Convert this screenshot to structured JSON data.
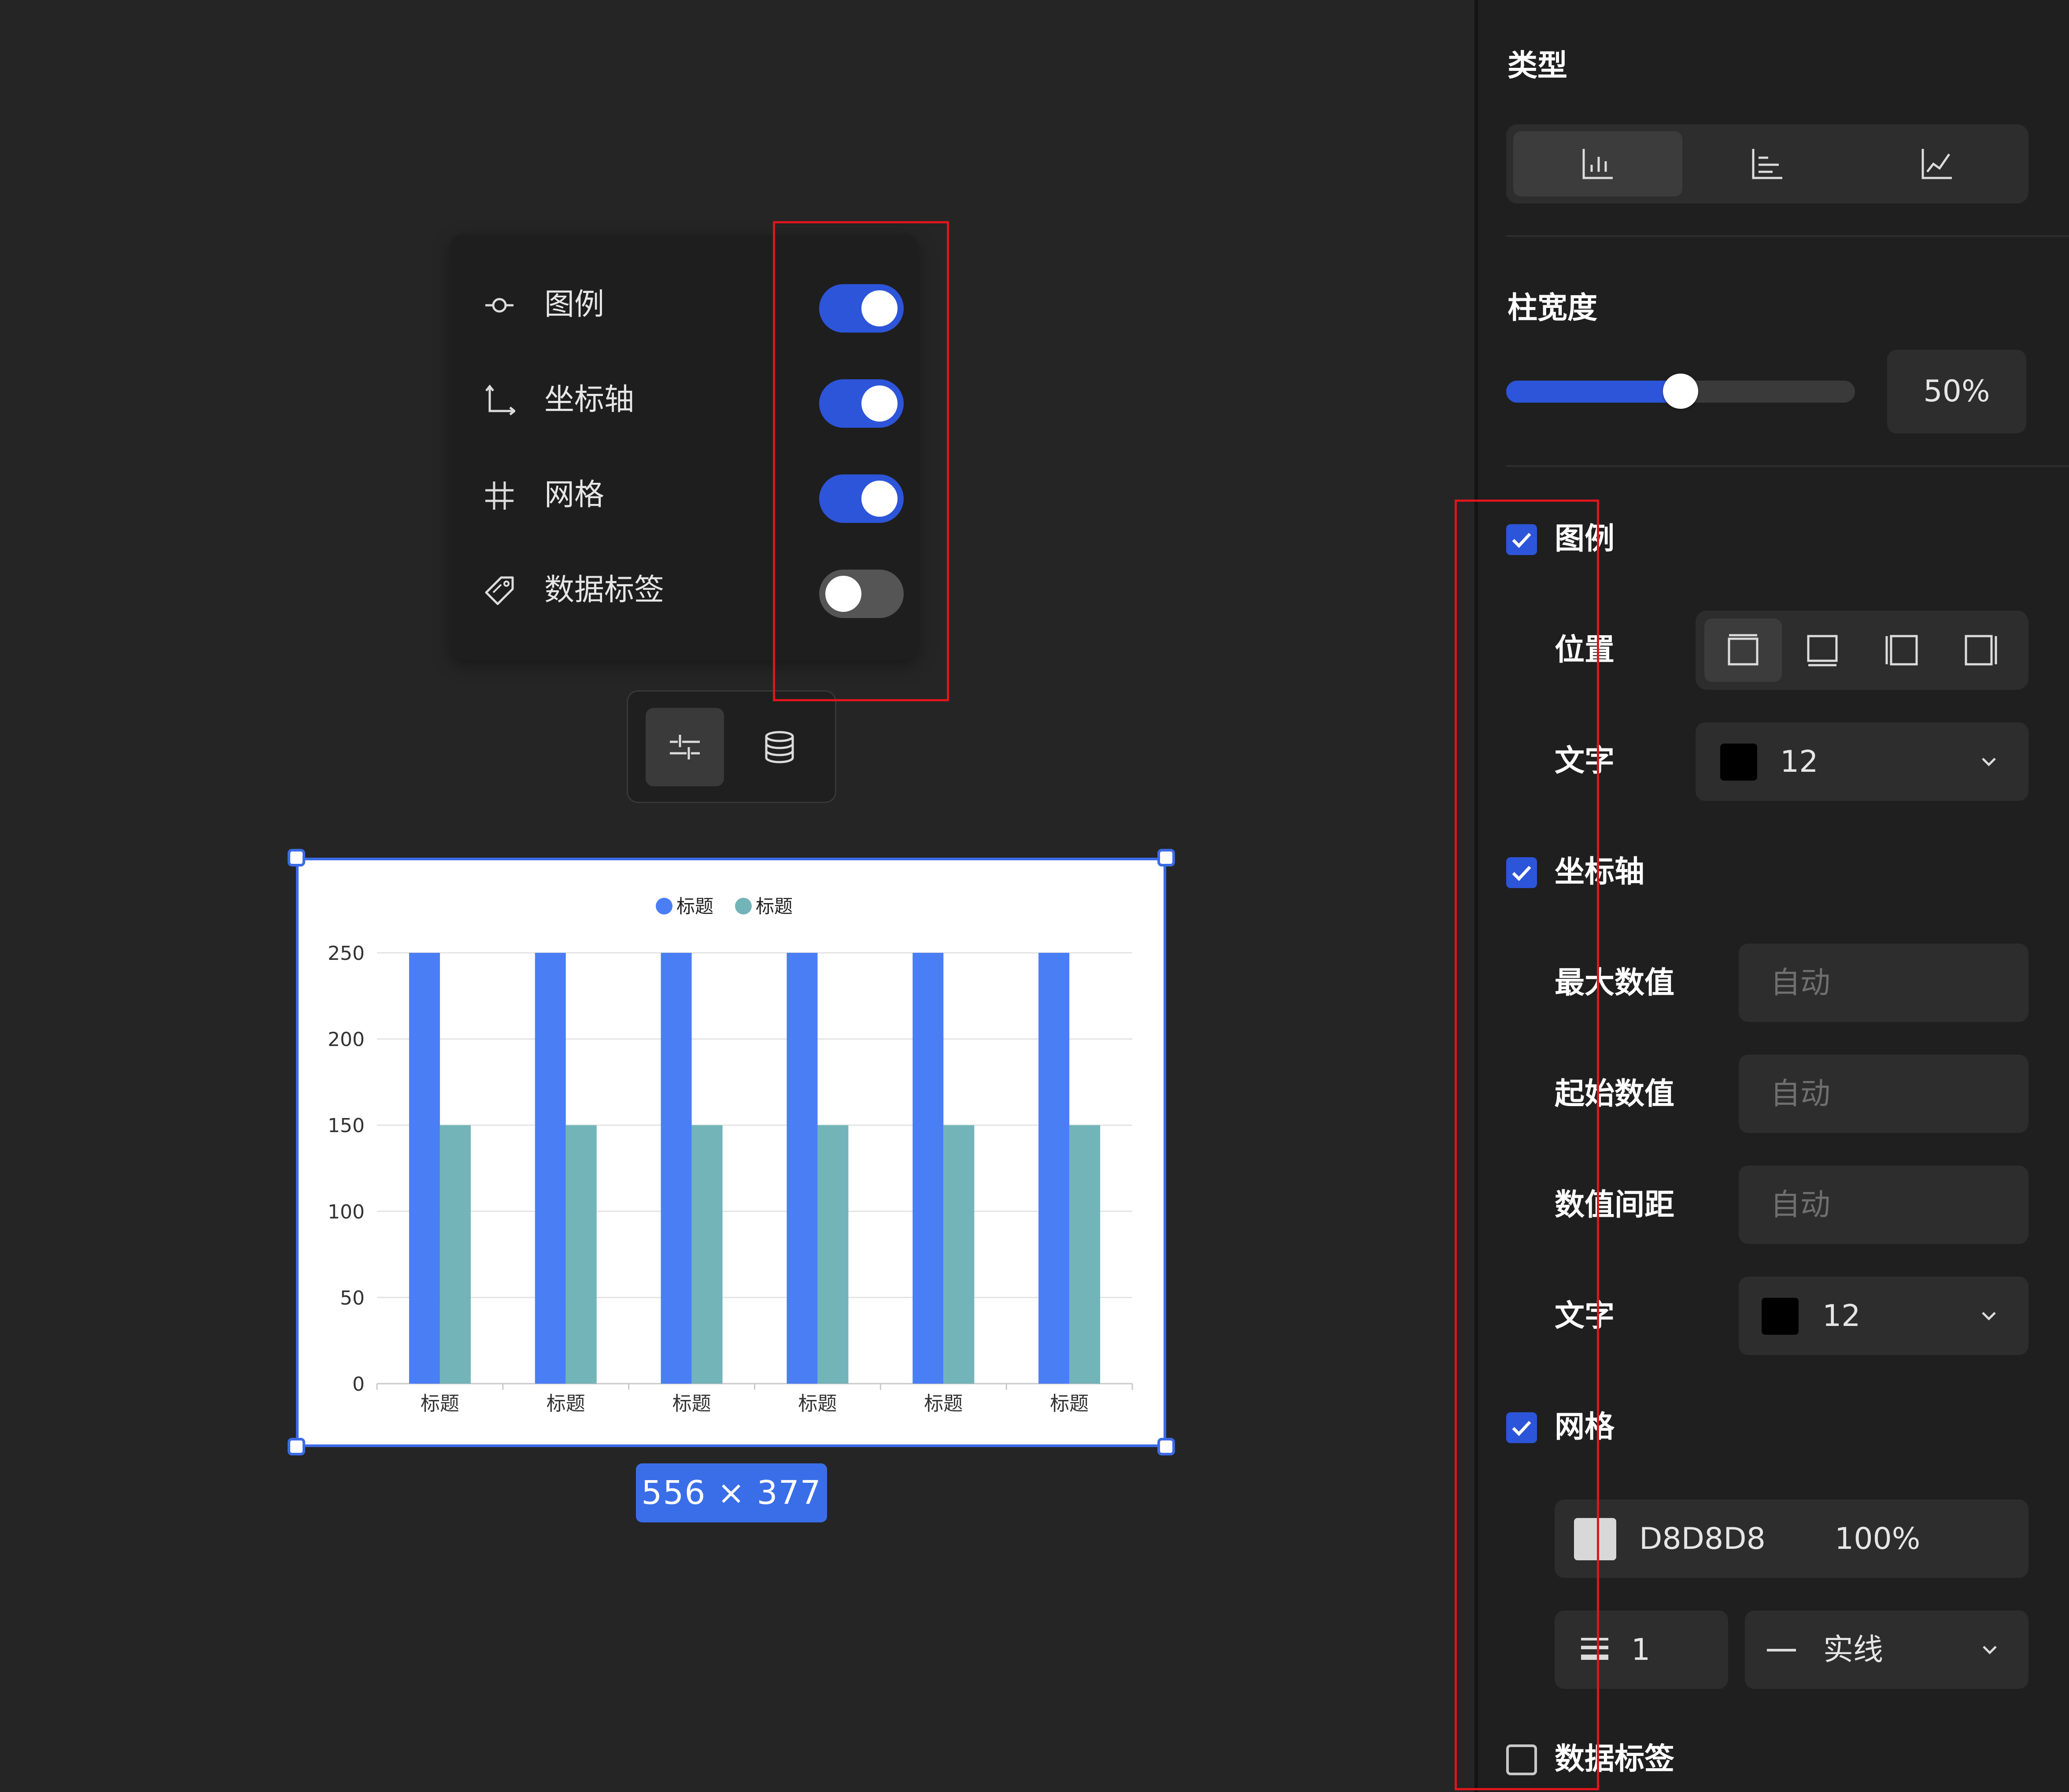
{
  "toggle_panel": {
    "items": [
      {
        "label": "图例",
        "icon": "legend-icon",
        "enabled": true
      },
      {
        "label": "坐标轴",
        "icon": "axis-icon",
        "enabled": true
      },
      {
        "label": "网格",
        "icon": "grid-icon",
        "enabled": true
      },
      {
        "label": "数据标签",
        "icon": "tag-icon",
        "enabled": false
      }
    ]
  },
  "mini_toolbar": {
    "buttons": [
      {
        "icon": "sliders-icon",
        "selected": true
      },
      {
        "icon": "database-icon",
        "selected": false
      }
    ]
  },
  "chart_size_badge": "556 × 377",
  "chart_data": {
    "type": "bar",
    "categories": [
      "标题",
      "标题",
      "标题",
      "标题",
      "标题",
      "标题"
    ],
    "series": [
      {
        "name": "标题",
        "color": "#4a7ef5",
        "values": [
          250,
          250,
          250,
          250,
          250,
          250
        ]
      },
      {
        "name": "标题",
        "color": "#73b4b9",
        "values": [
          150,
          150,
          150,
          150,
          150,
          150
        ]
      }
    ],
    "ylim": [
      0,
      250
    ],
    "yticks": [
      0,
      50,
      100,
      150,
      200,
      250
    ],
    "grid": true,
    "legend": "top-center"
  },
  "right_panel": {
    "type_label": "类型",
    "type_options": [
      {
        "icon": "bar-chart-icon",
        "selected": true
      },
      {
        "icon": "horizontal-bar-chart-icon",
        "selected": false
      },
      {
        "icon": "line-chart-icon",
        "selected": false
      }
    ],
    "bar_width_label": "柱宽度",
    "bar_width_value": "50%",
    "bar_width_fraction": 0.5,
    "legend": {
      "label": "图例",
      "checked": true,
      "position_label": "位置",
      "position_options": [
        "legend-top-icon",
        "legend-bottom-icon",
        "legend-left-icon",
        "legend-right-icon"
      ],
      "position_selected": 0,
      "text_label": "文字",
      "text_color": "#000000",
      "text_size": "12"
    },
    "axis": {
      "label": "坐标轴",
      "checked": true,
      "max_label": "最大数值",
      "max_placeholder": "自动",
      "start_label": "起始数值",
      "start_placeholder": "自动",
      "interval_label": "数值间距",
      "interval_placeholder": "自动",
      "text_label": "文字",
      "text_color": "#000000",
      "text_size": "12"
    },
    "grid": {
      "label": "网格",
      "checked": true,
      "color_hex": "D8D8D8",
      "color": "#D8D8D8",
      "opacity": "100%",
      "line_width": "1",
      "line_style": "实线"
    },
    "data_label": {
      "label": "数据标签",
      "checked": false
    }
  },
  "colors": {
    "accent": "#2d55d9",
    "highlight_box": "#e0151c"
  }
}
